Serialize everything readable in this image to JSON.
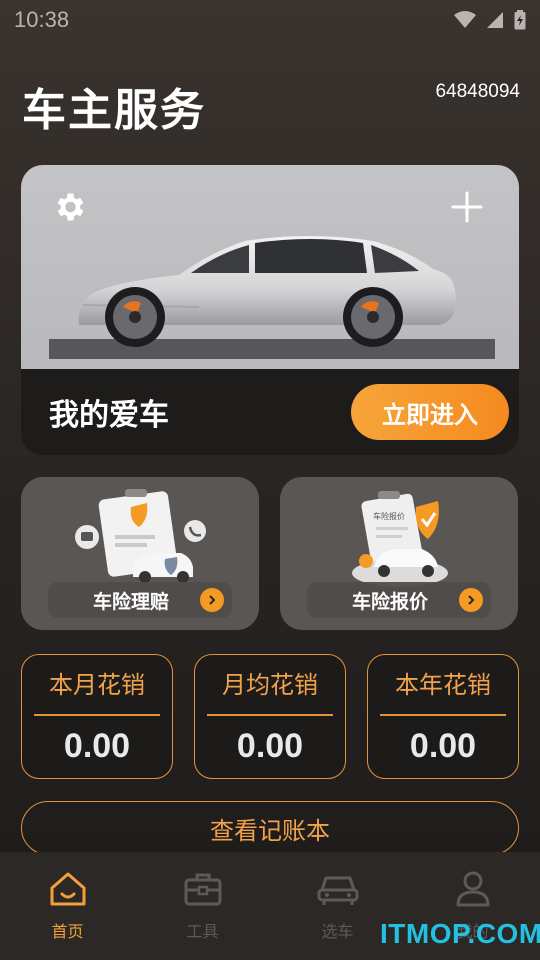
{
  "status_bar": {
    "time": "10:38"
  },
  "header": {
    "title": "车主服务",
    "user_id": "64848094"
  },
  "car_card": {
    "label": "我的爱车",
    "enter_button": "立即进入"
  },
  "services": [
    {
      "label": "车险理赔"
    },
    {
      "label": "车险报价",
      "card_text": "车险报价"
    }
  ],
  "stats": [
    {
      "label": "本月花销",
      "value": "0.00"
    },
    {
      "label": "月均花销",
      "value": "0.00"
    },
    {
      "label": "本年花销",
      "value": "0.00"
    }
  ],
  "ledger_button": "查看记账本",
  "tabs": [
    {
      "label": "首页",
      "icon": "home-icon",
      "active": true
    },
    {
      "label": "工具",
      "icon": "toolbox-icon",
      "active": false
    },
    {
      "label": "选车",
      "icon": "car-icon",
      "active": false
    },
    {
      "label": "我的",
      "icon": "user-icon",
      "active": false
    }
  ],
  "watermark": "ITMOP.COM",
  "colors": {
    "accent": "#f59b24",
    "background": "#2a2624",
    "tab_inactive": "#5f5a57",
    "card_gray": "#5a5654"
  }
}
